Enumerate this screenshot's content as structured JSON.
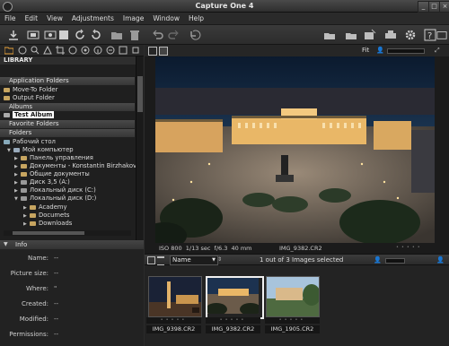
{
  "window": {
    "title": "Capture One 4"
  },
  "menu": [
    "File",
    "Edit",
    "View",
    "Adjustments",
    "Image",
    "Window",
    "Help"
  ],
  "viewer": {
    "fit_label": "Fit",
    "iso": "ISO 800",
    "shutter": "1/13 sec",
    "aperture": "f/6.3",
    "focal": "40 mm",
    "filename": "IMG_9382.CR2"
  },
  "library": {
    "header": "LIBRARY",
    "app_folders": "Application Folders",
    "move_to": "Move-To Folder",
    "output": "Output Folder",
    "albums": "Albums",
    "test_album": "Test Album",
    "favorite": "Favorite Folders",
    "folders": "Folders",
    "tree": [
      "Рабочий стол",
      "Мой компьютер",
      "Панель управления",
      "Документы - Konstantin Birzhakov",
      "Общие документы",
      "Диск 3,5 (A:)",
      "Локальный диск (C:)",
      "Локальный диск (D:)",
      "Academy",
      "Documets",
      "Downloads"
    ]
  },
  "info": {
    "title": "Info",
    "keys": [
      "Name:",
      "Picture size:",
      "Where:",
      "Created:",
      "Modified:",
      "Permissions:"
    ],
    "vals": [
      "--",
      "--",
      "\"",
      "--",
      "--",
      "--"
    ]
  },
  "browser": {
    "sort_label": "Name",
    "selection": "1 out of 3 Images selected",
    "thumbs": [
      "IMG_9398.CR2",
      "IMG_9382.CR2",
      "IMG_1905.CR2"
    ]
  },
  "colors": {
    "accent": "#e8a33a",
    "selected": "#ffffff"
  }
}
